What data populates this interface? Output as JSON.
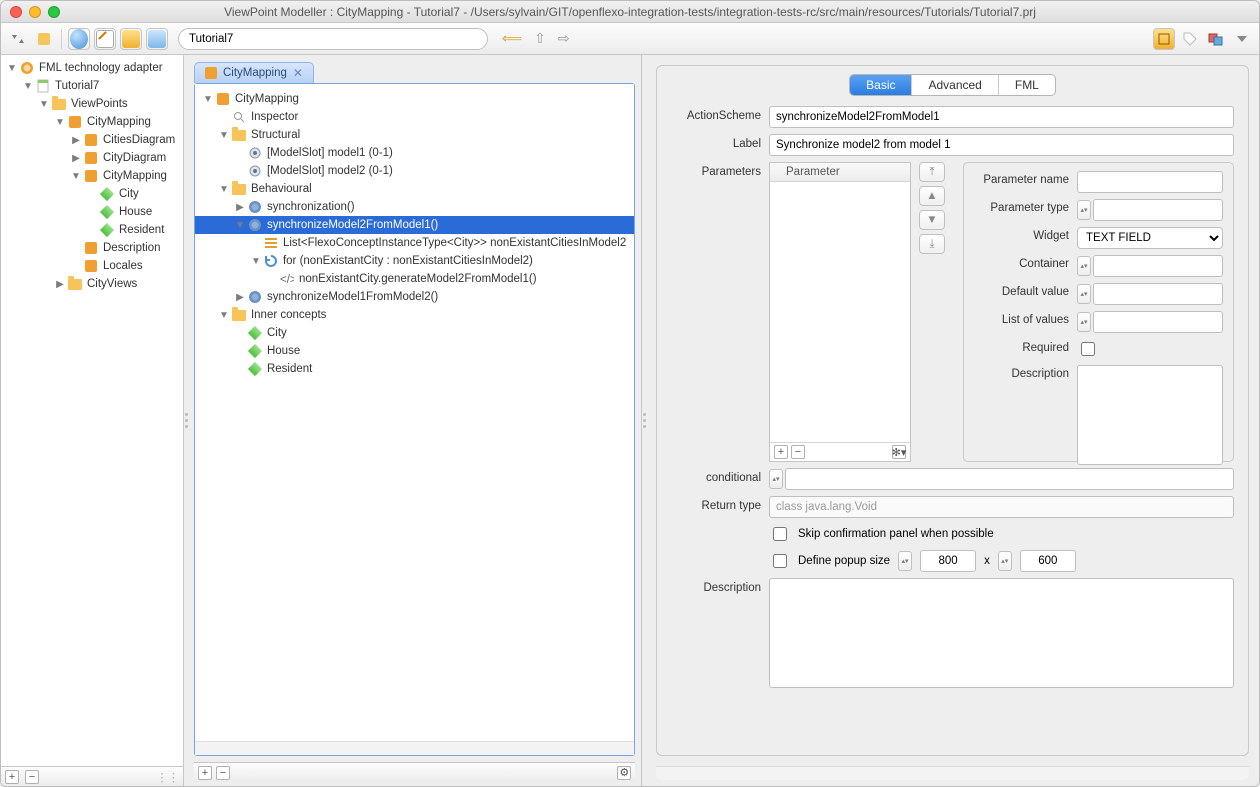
{
  "window": {
    "title": "ViewPoint Modeller : CityMapping - Tutorial7 - /Users/sylvain/GIT/openflexo-integration-tests/integration-tests-rc/src/main/resources/Tutorials/Tutorial7.prj"
  },
  "toolbar": {
    "address": "Tutorial7",
    "icons": [
      "expand-all",
      "map-edit",
      "globe",
      "draw",
      "package",
      "cube"
    ],
    "nav": [
      "back",
      "up",
      "forward"
    ]
  },
  "left_tree": {
    "root": "FML technology adapter",
    "items": [
      {
        "indent": 0,
        "toggle": "▼",
        "icon": "gear-orange",
        "label": "FML technology adapter"
      },
      {
        "indent": 1,
        "toggle": "▼",
        "icon": "doc",
        "label": "Tutorial7"
      },
      {
        "indent": 2,
        "toggle": "▼",
        "icon": "folder",
        "label": "ViewPoints"
      },
      {
        "indent": 3,
        "toggle": "▼",
        "icon": "puzzle",
        "label": "CityMapping"
      },
      {
        "indent": 4,
        "toggle": "▶",
        "icon": "puzzle",
        "label": "CitiesDiagram"
      },
      {
        "indent": 4,
        "toggle": "▶",
        "icon": "puzzle",
        "label": "CityDiagram"
      },
      {
        "indent": 4,
        "toggle": "▼",
        "icon": "puzzle",
        "label": "CityMapping"
      },
      {
        "indent": 5,
        "toggle": "",
        "icon": "diamond",
        "label": "City"
      },
      {
        "indent": 5,
        "toggle": "",
        "icon": "diamond",
        "label": "House"
      },
      {
        "indent": 5,
        "toggle": "",
        "icon": "diamond",
        "label": "Resident"
      },
      {
        "indent": 4,
        "toggle": "",
        "icon": "puzzle",
        "label": "Description"
      },
      {
        "indent": 4,
        "toggle": "",
        "icon": "puzzle",
        "label": "Locales"
      },
      {
        "indent": 3,
        "toggle": "▶",
        "icon": "folder",
        "label": "CityViews"
      }
    ]
  },
  "center": {
    "tab_label": "CityMapping",
    "tree": [
      {
        "indent": 0,
        "toggle": "▼",
        "icon": "puzzle",
        "label": "CityMapping",
        "sel": false
      },
      {
        "indent": 1,
        "toggle": "",
        "icon": "search",
        "label": "Inspector",
        "sel": false
      },
      {
        "indent": 1,
        "toggle": "▼",
        "icon": "folder",
        "label": "Structural",
        "sel": false
      },
      {
        "indent": 2,
        "toggle": "",
        "icon": "slot",
        "label": "[ModelSlot] model1 (0-1)",
        "sel": false
      },
      {
        "indent": 2,
        "toggle": "",
        "icon": "slot",
        "label": "[ModelSlot] model2 (0-1)",
        "sel": false
      },
      {
        "indent": 1,
        "toggle": "▼",
        "icon": "folder",
        "label": "Behavioural",
        "sel": false
      },
      {
        "indent": 2,
        "toggle": "▶",
        "icon": "gear",
        "label": "synchronization()",
        "sel": false
      },
      {
        "indent": 2,
        "toggle": "▼",
        "icon": "gear",
        "label": "synchronizeModel2FromModel1()",
        "sel": true
      },
      {
        "indent": 3,
        "toggle": "",
        "icon": "list",
        "label": "List<FlexoConceptInstanceType<City>> nonExistantCitiesInModel2",
        "sel": false
      },
      {
        "indent": 3,
        "toggle": "▼",
        "icon": "loop",
        "label": "for (nonExistantCity : nonExistantCitiesInModel2)",
        "sel": false
      },
      {
        "indent": 4,
        "toggle": "",
        "icon": "code",
        "label": "nonExistantCity.generateModel2FromModel1()",
        "sel": false
      },
      {
        "indent": 2,
        "toggle": "▶",
        "icon": "gear",
        "label": "synchronizeModel1FromModel2()",
        "sel": false
      },
      {
        "indent": 1,
        "toggle": "▼",
        "icon": "folder",
        "label": "Inner concepts",
        "sel": false
      },
      {
        "indent": 2,
        "toggle": "",
        "icon": "diamond",
        "label": "City",
        "sel": false
      },
      {
        "indent": 2,
        "toggle": "",
        "icon": "diamond",
        "label": "House",
        "sel": false
      },
      {
        "indent": 2,
        "toggle": "",
        "icon": "diamond",
        "label": "Resident",
        "sel": false
      }
    ]
  },
  "right": {
    "segments": [
      "Basic",
      "Advanced",
      "FML"
    ],
    "active_segment": 0,
    "labels": {
      "action_scheme": "ActionScheme",
      "label": "Label",
      "parameters": "Parameters",
      "conditional": "conditional",
      "return_type": "Return type",
      "skip_confirm": "Skip confirmation panel when possible",
      "define_popup": "Define popup size",
      "description": "Description",
      "param_header": "Parameter",
      "param_name": "Parameter name",
      "param_type": "Parameter type",
      "widget": "Widget",
      "container": "Container",
      "default_value": "Default value",
      "list_values": "List of values",
      "required": "Required",
      "x": "x"
    },
    "values": {
      "action_scheme": "synchronizeModel2FromModel1",
      "label": "Synchronize model2 from model 1",
      "conditional": "",
      "return_type": "class java.lang.Void",
      "widget": "TEXT FIELD",
      "popup_w": "800",
      "popup_h": "600",
      "skip_confirm": false,
      "define_popup": false
    }
  }
}
